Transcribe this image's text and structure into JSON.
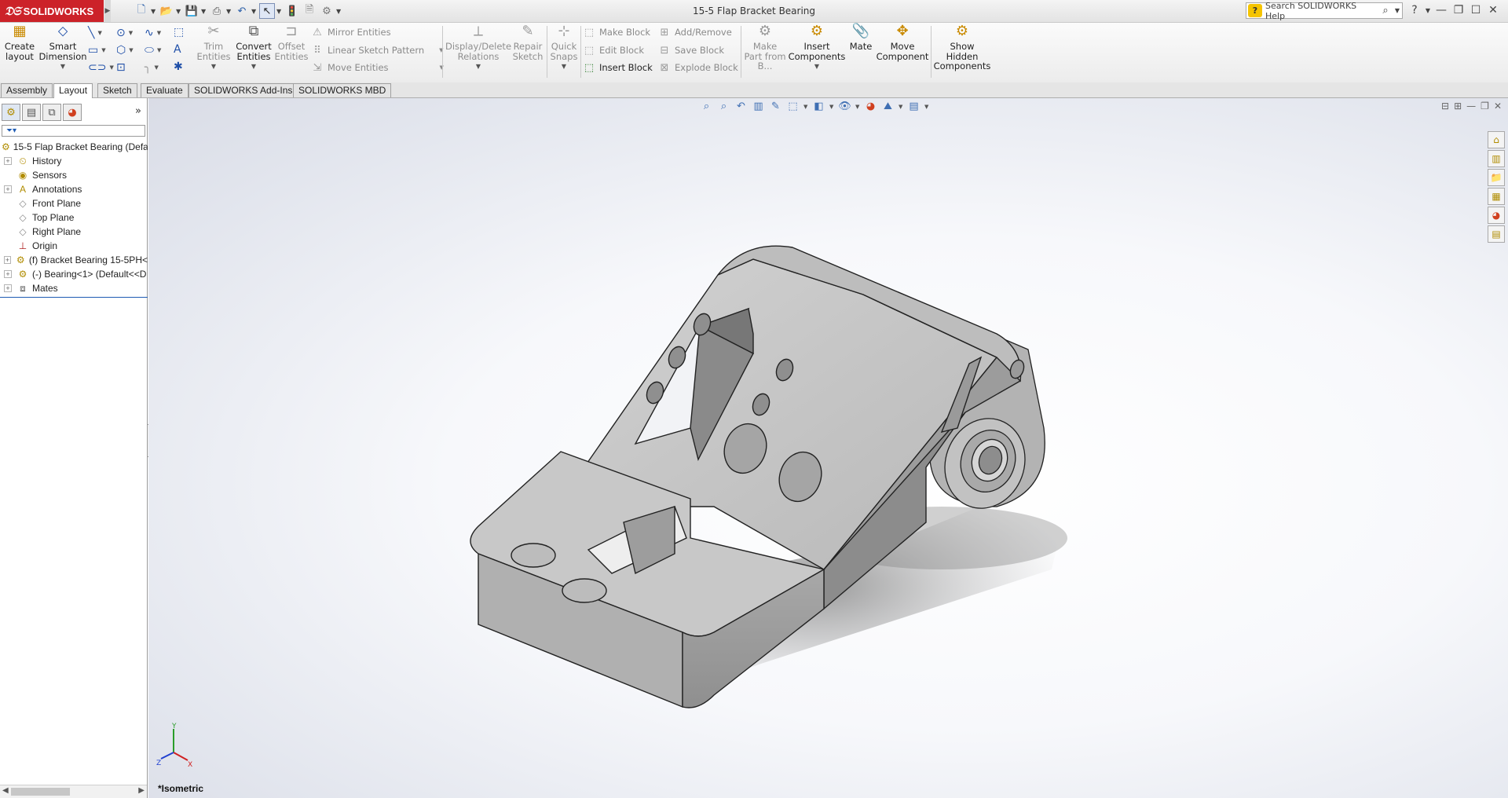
{
  "app": {
    "brand": "SOLIDWORKS",
    "document_title": "15-5 Flap Bracket Bearing",
    "search_placeholder": "Search SOLIDWORKS Help"
  },
  "ribbon": {
    "create_layout": "Create layout",
    "smart_dimension": "Smart Dimension",
    "trim_entities": "Trim Entities",
    "convert_entities": "Convert Entities",
    "offset_entities": "Offset Entities",
    "mirror_entities": "Mirror Entities",
    "linear_sketch_pattern": "Linear Sketch Pattern",
    "move_entities": "Move Entities",
    "display_delete_relations": "Display/Delete Relations",
    "repair_sketch": "Repair Sketch",
    "quick_snaps": "Quick Snaps",
    "make_block": "Make Block",
    "edit_block": "Edit Block",
    "insert_block": "Insert Block",
    "add_remove": "Add/Remove",
    "save_block": "Save Block",
    "explode_block": "Explode Block",
    "make_part_from_block": "Make Part from B...",
    "insert_components": "Insert Components",
    "mate": "Mate",
    "move_component": "Move Component",
    "show_hidden_components": "Show Hidden Components"
  },
  "tabs": [
    "Assembly",
    "Layout",
    "Sketch",
    "Evaluate",
    "SOLIDWORKS Add-Ins",
    "SOLIDWORKS MBD"
  ],
  "active_tab": "Layout",
  "feature_tree": {
    "root": "15-5 Flap Bracket Bearing  (Defa",
    "items": [
      {
        "label": "History",
        "icon": "history-folder-icon",
        "expandable": true
      },
      {
        "label": "Sensors",
        "icon": "sensor-icon",
        "expandable": false
      },
      {
        "label": "Annotations",
        "icon": "annotation-icon",
        "expandable": true
      },
      {
        "label": "Front Plane",
        "icon": "plane-icon",
        "expandable": false
      },
      {
        "label": "Top Plane",
        "icon": "plane-icon",
        "expandable": false
      },
      {
        "label": "Right Plane",
        "icon": "plane-icon",
        "expandable": false
      },
      {
        "label": "Origin",
        "icon": "origin-icon",
        "expandable": false
      },
      {
        "label": "(f) Bracket Bearing 15-5PH<",
        "icon": "part-icon",
        "expandable": true
      },
      {
        "label": "(-) Bearing<1> (Default<<D",
        "icon": "part-icon",
        "expandable": true
      },
      {
        "label": "Mates",
        "icon": "mates-icon",
        "expandable": true
      }
    ]
  },
  "viewport": {
    "view_name": "*Isometric",
    "triad_labels": {
      "x": "X",
      "y": "Y",
      "z": "Z"
    }
  }
}
